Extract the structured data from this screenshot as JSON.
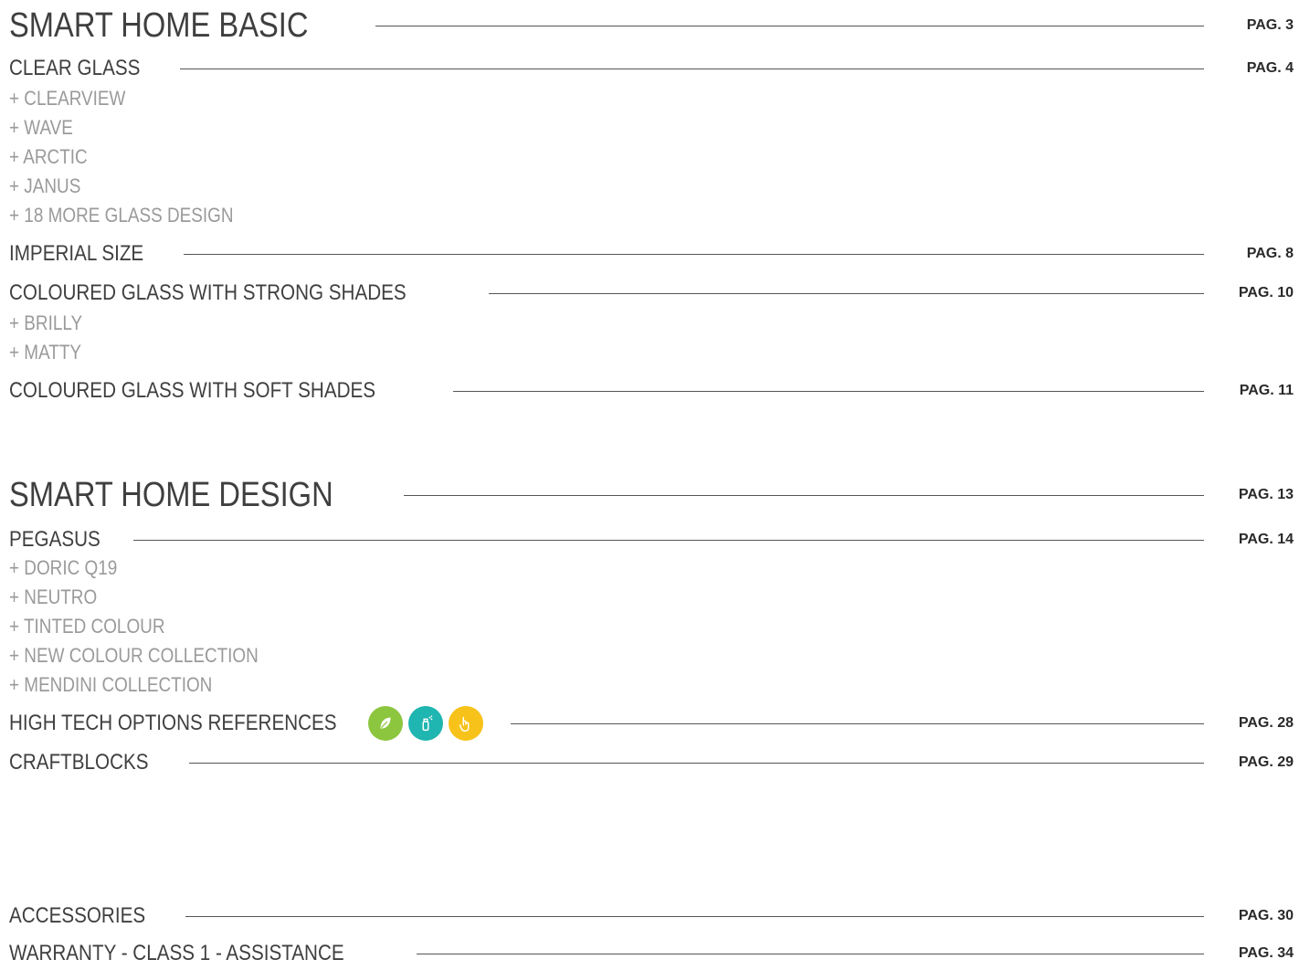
{
  "basic": {
    "title": "SMART HOME BASIC",
    "page": "PAG. 3",
    "clear_glass": {
      "title": "CLEAR GLASS",
      "page": "PAG. 4",
      "items": [
        "+ CLEARVIEW",
        "+ WAVE",
        "+ ARCTIC",
        "+ JANUS",
        "+ 18 MORE GLASS DESIGN"
      ]
    },
    "imperial": {
      "title": "IMPERIAL SIZE",
      "page": "PAG. 8"
    },
    "strong": {
      "title": "COLOURED GLASS WITH STRONG SHADES",
      "page": "PAG. 10",
      "items": [
        "+ BRILLY",
        "+ MATTY"
      ]
    },
    "soft": {
      "title": "COLOURED GLASS WITH SOFT SHADES",
      "page": "PAG. 11"
    }
  },
  "design": {
    "title": "SMART HOME DESIGN",
    "page": "PAG. 13",
    "pegasus": {
      "title": "PEGASUS",
      "page": "PAG. 14",
      "items": [
        "+ DORIC Q19",
        "+ NEUTRO",
        "+ TINTED COLOUR",
        "+ NEW COLOUR COLLECTION",
        "+ MENDINI COLLECTION"
      ]
    },
    "hightech": {
      "title": "HIGH TECH OPTIONS REFERENCES",
      "page": "PAG. 28",
      "icons": [
        {
          "name": "leaf-icon",
          "color": "#8cc63f"
        },
        {
          "name": "spray-icon",
          "color": "#1fb5b0"
        },
        {
          "name": "touch-icon",
          "color": "#f7c21a"
        }
      ]
    },
    "craftblocks": {
      "title": "CRAFTBLOCKS",
      "page": "PAG. 29"
    }
  },
  "other": {
    "accessories": {
      "title": "ACCESSORIES",
      "page": "PAG. 30"
    },
    "warranty": {
      "title": "WARRANTY - CLASS 1 - ASSISTANCE",
      "page": "PAG. 34"
    }
  }
}
